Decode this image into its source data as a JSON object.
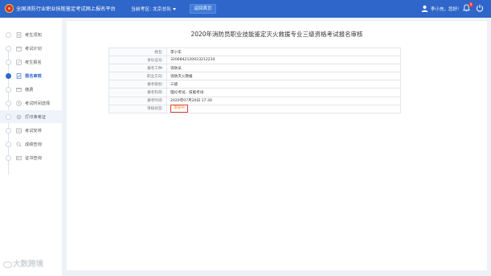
{
  "header": {
    "title": "全国消防行业职业技能鉴定考试网上报名平台",
    "region_label": "当前考区: 北京总队",
    "home_button": "返回首页",
    "user_greeting": "李小充，您好!",
    "notification_count": "0"
  },
  "sidebar": {
    "items": [
      {
        "label": "考生须知"
      },
      {
        "label": "考试计划"
      },
      {
        "label": "考生报名"
      },
      {
        "label": "报名审核"
      },
      {
        "label": "缴费"
      },
      {
        "label": "考试时间选择"
      },
      {
        "label": "打印准考证"
      },
      {
        "label": "考试安排"
      },
      {
        "label": "成绩查询"
      },
      {
        "label": "证书查询"
      }
    ]
  },
  "main": {
    "title": "2020年消防员职业技能鉴定灭火救援专业三级资格考试报名审核",
    "rows": [
      {
        "key": "姓名:",
        "value": "李小东"
      },
      {
        "key": "身份证号:",
        "value": "320684212002321223X"
      },
      {
        "key": "报考工种:",
        "value": "消防员"
      },
      {
        "key": "职业方向:",
        "value": "消防灭火救援"
      },
      {
        "key": "报考级别:",
        "value": "三级"
      },
      {
        "key": "报考科目:",
        "value": "理论考试、技能考试"
      },
      {
        "key": "报考时间:",
        "value": "2020年07月20日  17:30"
      }
    ],
    "status_key": "审核状态:",
    "status_value": "审核中"
  },
  "watermark": "大数跨境",
  "colors": {
    "header_bg": "#2e66c9",
    "accent": "#2e66c9",
    "status_text": "#f08a24",
    "status_border": "#e23b3b"
  }
}
